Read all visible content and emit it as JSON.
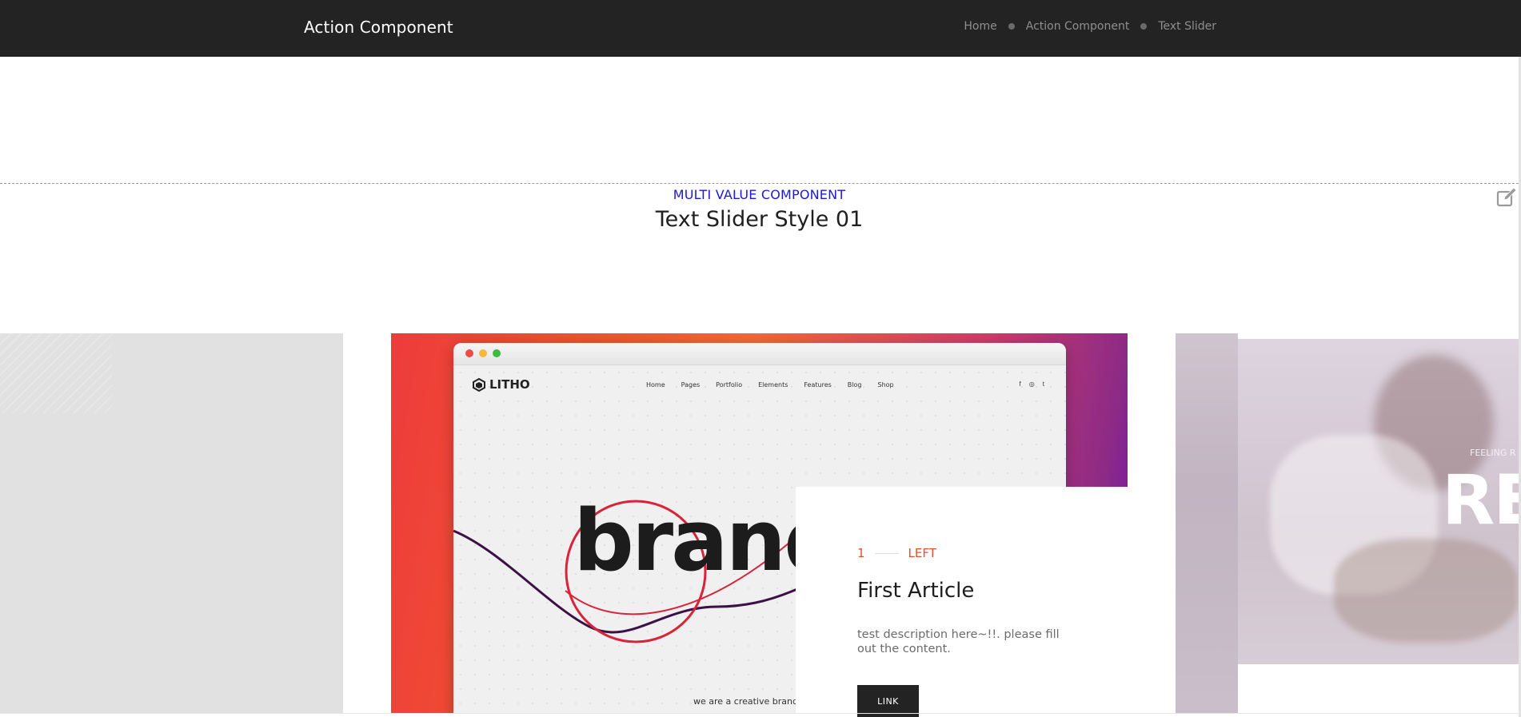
{
  "header": {
    "title": "Action Component",
    "breadcrumb": [
      {
        "label": "Home"
      },
      {
        "label": "Action Component"
      },
      {
        "label": "Text Slider"
      }
    ]
  },
  "section": {
    "eyebrow": "MULTI VALUE COMPONENT",
    "title": "Text Slider Style 01"
  },
  "slider": {
    "mock_site": {
      "logo": "LITHO",
      "nav": [
        "Home",
        "Pages",
        "Portfolio",
        "Elements",
        "Features",
        "Blog",
        "Shop"
      ],
      "social": [
        "f",
        "◎",
        "t"
      ],
      "hero_word": "brand",
      "caption": "we are a creative branding"
    },
    "card": {
      "number": "1",
      "direction": "LEFT",
      "title": "First Article",
      "description": "test description here~!!. please fill out the content.",
      "link_label": "LINK"
    },
    "right_slide": {
      "eyebrow": "FEELING R",
      "headline": "RES"
    }
  },
  "colors": {
    "header_bg": "#232323",
    "eyebrow_blue": "#1a1adf",
    "accent_orange": "#e2512f"
  },
  "icons": {
    "edit": "edit-icon"
  }
}
